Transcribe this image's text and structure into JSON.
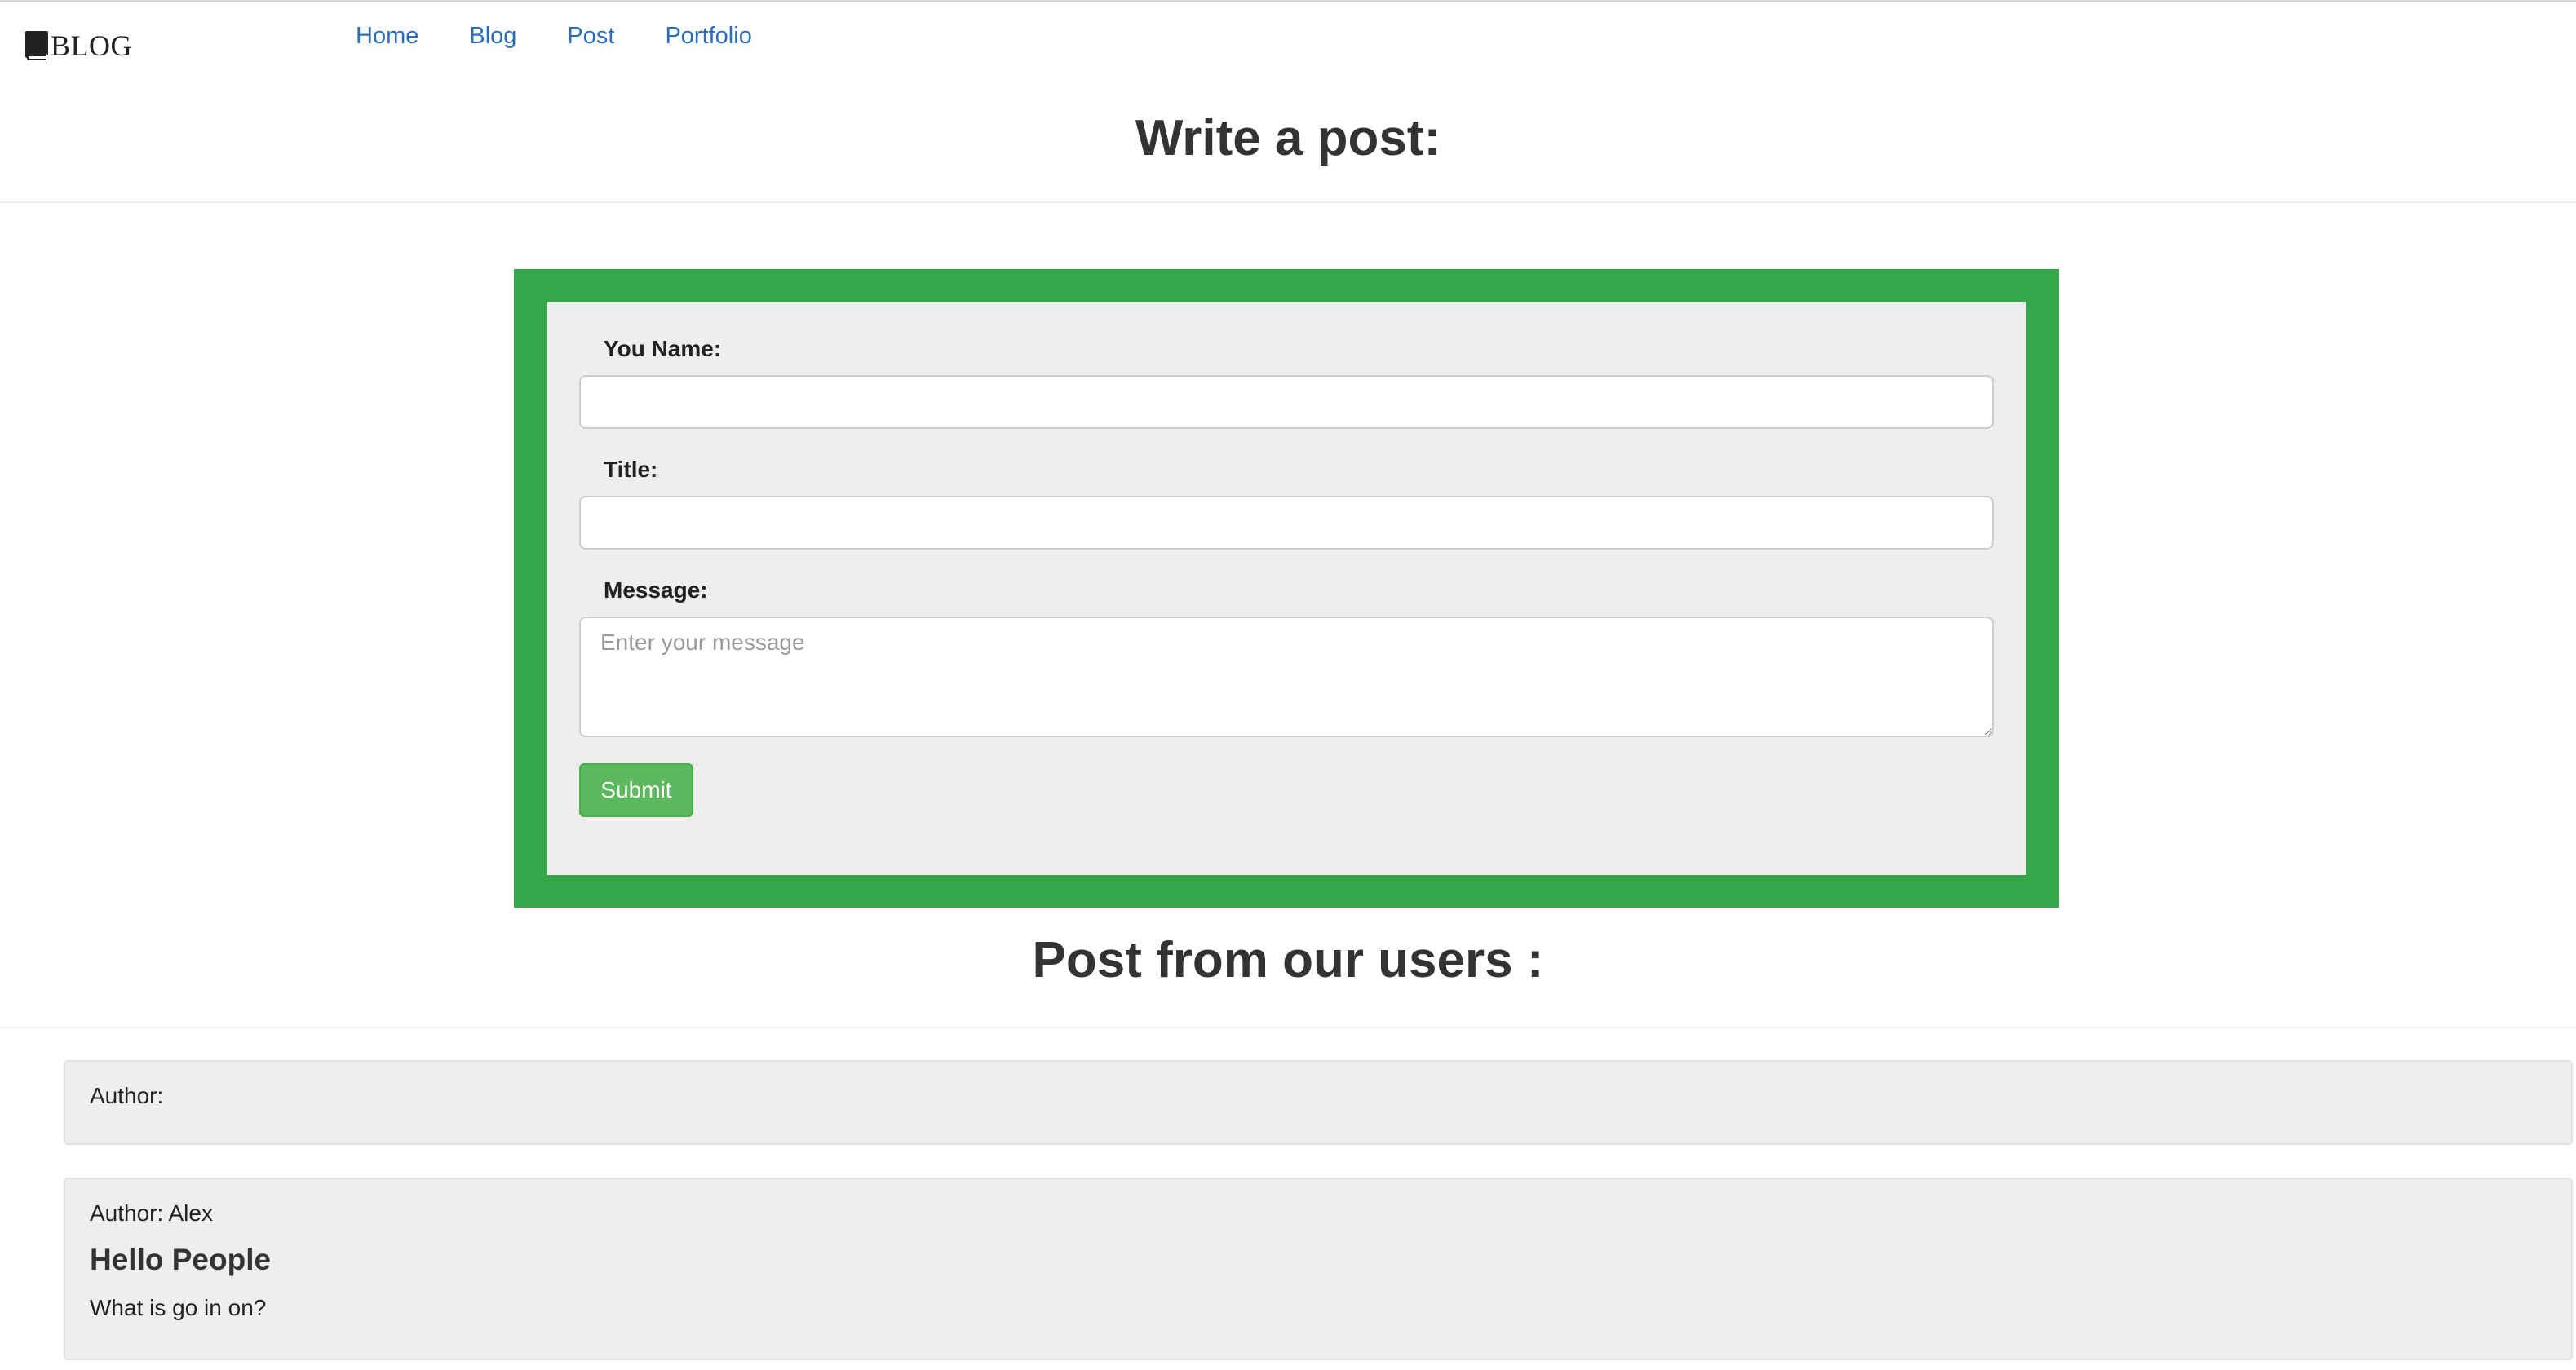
{
  "brand": {
    "icon": "book-icon",
    "text": "BLOG"
  },
  "nav": {
    "items": [
      {
        "label": "Home"
      },
      {
        "label": "Blog"
      },
      {
        "label": "Post"
      },
      {
        "label": "Portfolio"
      }
    ]
  },
  "write_section": {
    "title": "Write a post:"
  },
  "form": {
    "name_label": "You Name:",
    "name_value": "",
    "title_label": "Title:",
    "title_value": "",
    "message_label": "Message:",
    "message_placeholder": "Enter your message",
    "submit_label": "Submit"
  },
  "posts_section": {
    "title": "Post from our users :"
  },
  "posts": [
    {
      "author_line": "Author:"
    },
    {
      "author_line": "Author: Alex",
      "title": "Hello People",
      "message": "What is go in on?"
    }
  ],
  "colors": {
    "form_frame": "#36a64b",
    "submit_button": "#5cb85c",
    "link": "#2a6ebb",
    "panel": "#eeeeee"
  }
}
